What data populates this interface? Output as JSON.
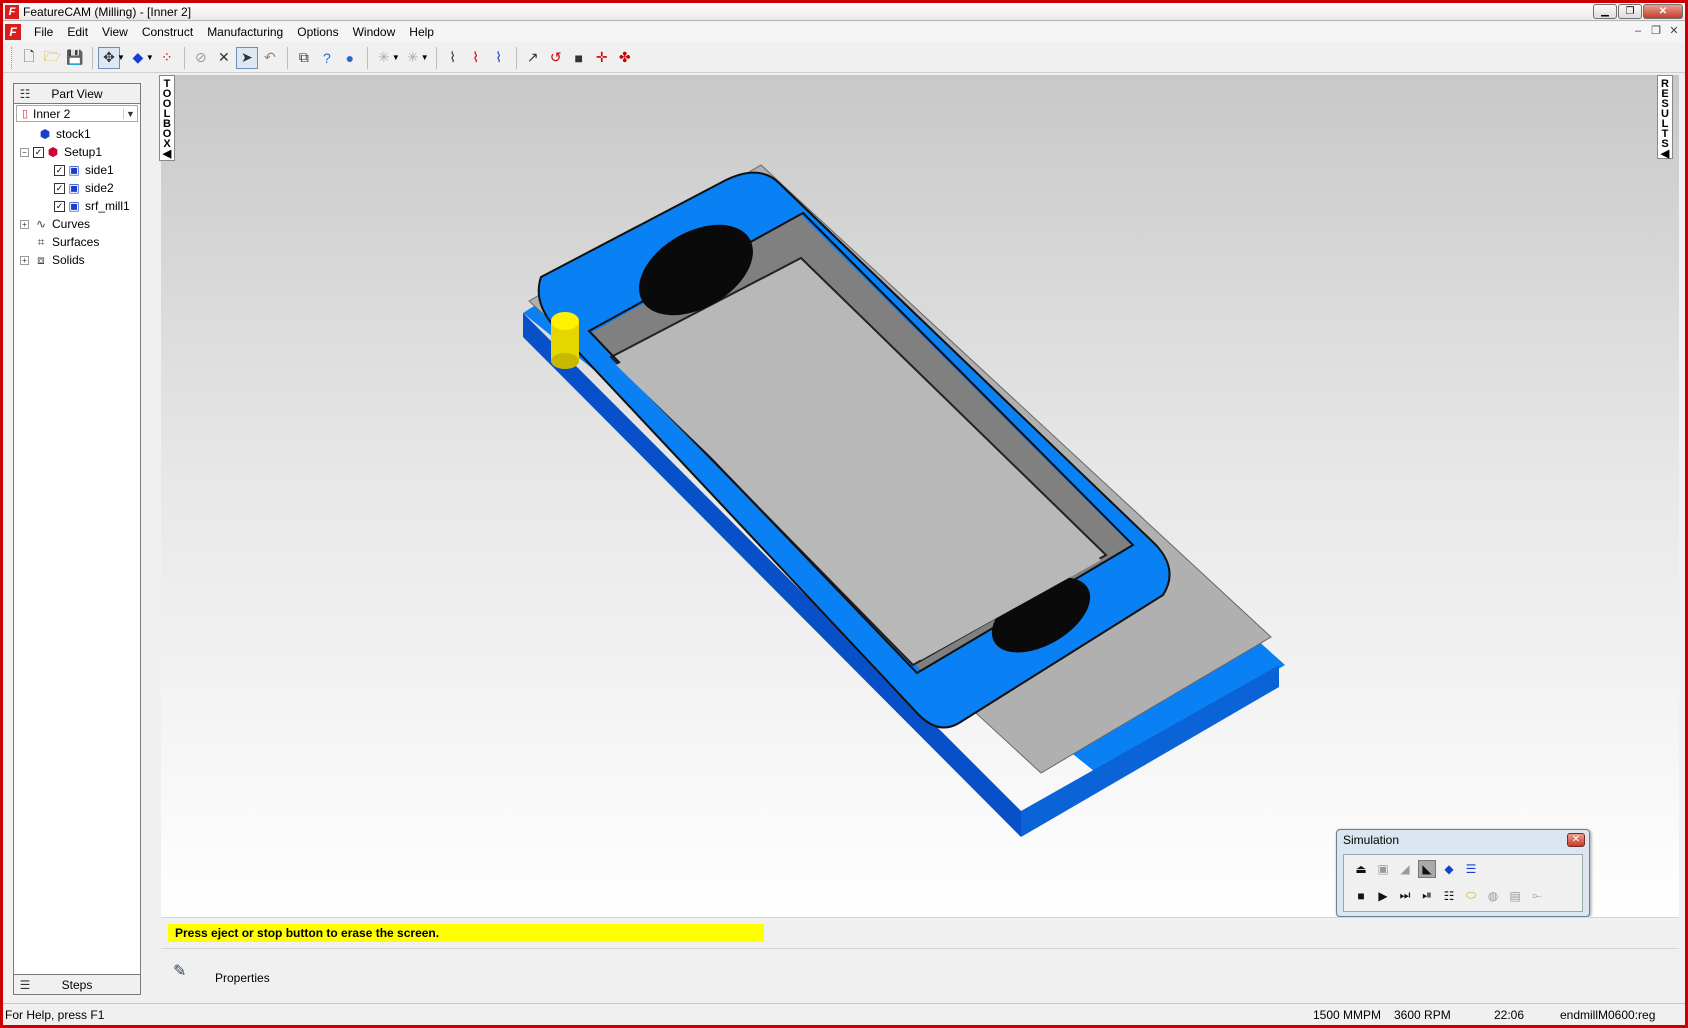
{
  "window": {
    "title": "FeatureCAM (Milling) - [Inner 2]"
  },
  "menu": [
    "File",
    "Edit",
    "View",
    "Construct",
    "Manufacturing",
    "Options",
    "Window",
    "Help"
  ],
  "left_panel": {
    "top_tab": "Part View",
    "document": "Inner 2",
    "tree": {
      "stock": "stock1",
      "setup": "Setup1",
      "features": [
        "side1",
        "side2",
        "srf_mill1"
      ],
      "curves": "Curves",
      "surfaces": "Surfaces",
      "solids": "Solids"
    },
    "bottom_tab": "Steps"
  },
  "side_tabs": {
    "toolbox": "TOOLBOX",
    "results": "RESULTS"
  },
  "simulation": {
    "title": "Simulation"
  },
  "message": "Press eject or stop button to erase the screen.",
  "properties_label": "Properties",
  "status": {
    "help": "For Help, press F1",
    "feed": "1500 MMPM",
    "speed": "3600 RPM",
    "time": "22:06",
    "tool": "endmillM0600:reg"
  },
  "colors": {
    "part_blue": "#0a80f5",
    "tool_yellow": "#f5e600",
    "window_border": "#cc0000"
  }
}
